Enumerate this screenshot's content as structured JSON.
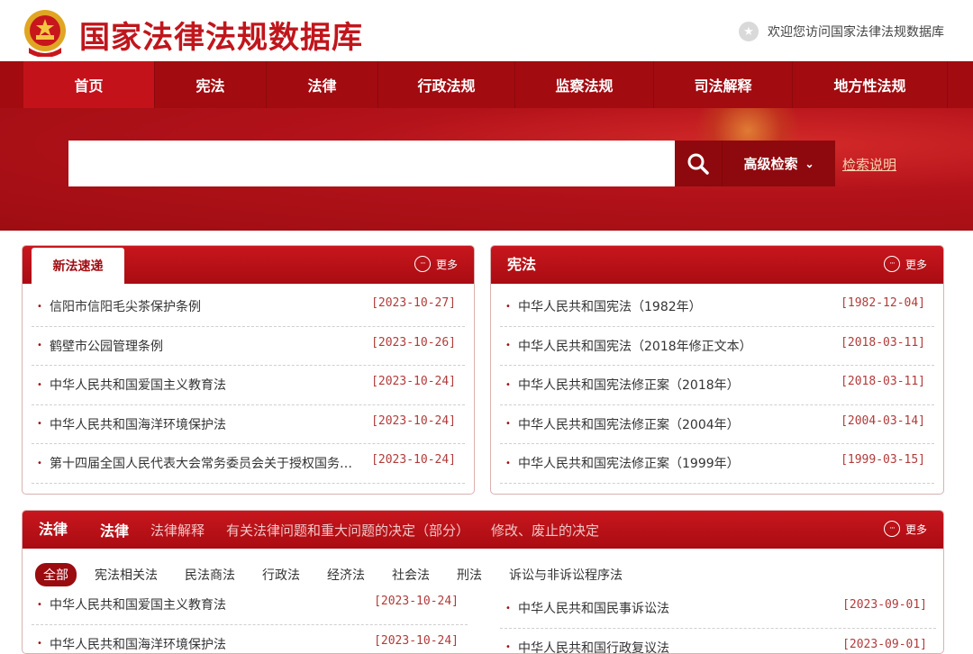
{
  "header": {
    "site_title": "国家法律法规数据库",
    "welcome": "欢迎您访问国家法律法规数据库"
  },
  "nav": [
    {
      "label": "首页",
      "active": true
    },
    {
      "label": "宪法"
    },
    {
      "label": "法律"
    },
    {
      "label": "行政法规"
    },
    {
      "label": "监察法规"
    },
    {
      "label": "司法解释"
    },
    {
      "label": "地方性法规"
    }
  ],
  "search": {
    "placeholder": "",
    "advanced_label": "高级检索",
    "help_label": "检索说明"
  },
  "new_laws": {
    "tab_label": "新法速递",
    "more_label": "更多",
    "items": [
      {
        "title": "信阳市信阳毛尖茶保护条例",
        "date": "[2023-10-27]"
      },
      {
        "title": "鹤壁市公园管理条例",
        "date": "[2023-10-26]"
      },
      {
        "title": "中华人民共和国爱国主义教育法",
        "date": "[2023-10-24]"
      },
      {
        "title": "中华人民共和国海洋环境保护法",
        "date": "[2023-10-24]"
      },
      {
        "title": "第十四届全国人民代表大会常务委员会关于授权国务院…",
        "date": "[2023-10-24]"
      }
    ]
  },
  "constitution": {
    "title": "宪法",
    "more_label": "更多",
    "items": [
      {
        "title": "中华人民共和国宪法（1982年）",
        "date": "[1982-12-04]"
      },
      {
        "title": "中华人民共和国宪法（2018年修正文本）",
        "date": "[2018-03-11]"
      },
      {
        "title": "中华人民共和国宪法修正案（2018年）",
        "date": "[2018-03-11]"
      },
      {
        "title": "中华人民共和国宪法修正案（2004年）",
        "date": "[2004-03-14]"
      },
      {
        "title": "中华人民共和国宪法修正案（1999年）",
        "date": "[1999-03-15]"
      }
    ]
  },
  "laws": {
    "title": "法律",
    "more_label": "更多",
    "tabs": [
      "法律",
      "法律解释",
      "有关法律问题和重大问题的决定（部分）",
      "修改、废止的决定"
    ],
    "filters": [
      "全部",
      "宪法相关法",
      "民法商法",
      "行政法",
      "经济法",
      "社会法",
      "刑法",
      "诉讼与非诉讼程序法"
    ],
    "left_items": [
      {
        "title": "中华人民共和国爱国主义教育法",
        "date": "[2023-10-24]"
      },
      {
        "title": "中华人民共和国海洋环境保护法",
        "date": "[2023-10-24]"
      }
    ],
    "right_items": [
      {
        "title": "中华人民共和国民事诉讼法",
        "date": "[2023-09-01]"
      },
      {
        "title": "中华人民共和国行政复议法",
        "date": "[2023-09-01]"
      }
    ]
  },
  "colors": {
    "brand_red": "#a20b10",
    "date_red": "#b23a3a"
  },
  "icons": [
    "national-emblem-icon",
    "star-icon",
    "search-icon",
    "chevron-down-icon",
    "more-circle-icon",
    "bullet-icon"
  ]
}
